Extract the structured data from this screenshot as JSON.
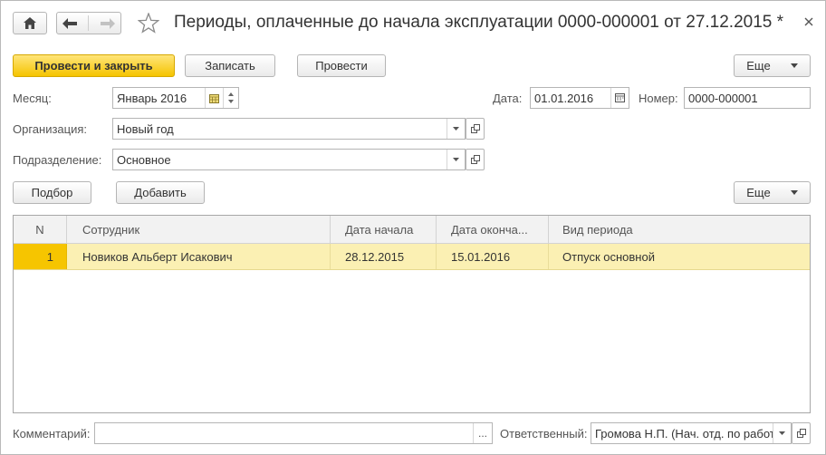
{
  "window": {
    "title": "Периоды, оплаченные до начала эксплуатации 0000-000001 от 27.12.2015 *"
  },
  "toolbar": {
    "post_close_label": "Провести и закрыть",
    "save_label": "Записать",
    "post_label": "Провести",
    "more_label": "Еще"
  },
  "form": {
    "month_label": "Месяц:",
    "month_value": "Январь 2016",
    "date_label": "Дата:",
    "date_value": "01.01.2016",
    "number_label": "Номер:",
    "number_value": "0000-000001",
    "org_label": "Организация:",
    "org_value": "Новый год",
    "dept_label": "Подразделение:",
    "dept_value": "Основное"
  },
  "table_toolbar": {
    "select_label": "Подбор",
    "add_label": "Добавить",
    "more_label": "Еще"
  },
  "table": {
    "columns": [
      "N",
      "Сотрудник",
      "Дата начала",
      "Дата оконча...",
      "Вид периода"
    ],
    "rows": [
      {
        "n": "1",
        "employee": "Новиков Альберт Исакович",
        "start": "28.12.2015",
        "end": "15.01.2016",
        "kind": "Отпуск основной"
      }
    ]
  },
  "footer": {
    "comment_label": "Комментарий:",
    "comment_value": "",
    "comment_button": "...",
    "responsible_label": "Ответственный:",
    "responsible_value": "Громова Н.П. (Нач. отд. по работе"
  },
  "colors": {
    "accent": "#f5c400",
    "selected_row": "#fbf0b3"
  },
  "icons": [
    "home-icon",
    "back-arrow-icon",
    "forward-arrow-icon",
    "star-icon",
    "close-icon",
    "calendar-icon",
    "dropdown-icon",
    "open-icon"
  ]
}
